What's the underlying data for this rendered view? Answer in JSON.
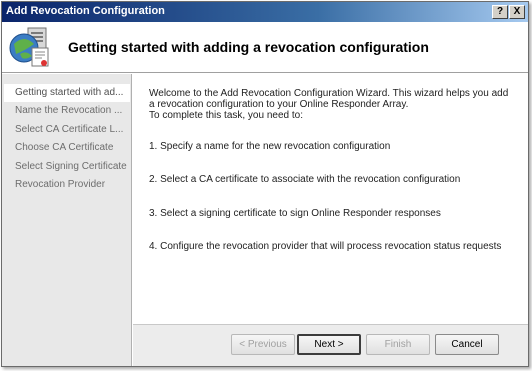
{
  "window": {
    "title": "Add Revocation Configuration",
    "help_glyph": "?",
    "close_glyph": "X"
  },
  "header": {
    "title": "Getting started with adding a revocation configuration"
  },
  "sidebar": {
    "items": [
      {
        "label": "Getting started with ad..."
      },
      {
        "label": "Name the Revocation ..."
      },
      {
        "label": "Select CA Certificate L..."
      },
      {
        "label": "Choose CA Certificate"
      },
      {
        "label": "Select Signing Certificate"
      },
      {
        "label": "Revocation Provider"
      }
    ]
  },
  "content": {
    "intro_line1": "Welcome to the Add Revocation Configuration Wizard. This wizard helps you add",
    "intro_line2": "a revocation configuration to your Online Responder Array.",
    "intro_line3": "To complete this task, you need to:",
    "step1": "1. Specify a name for the new revocation configuration",
    "step2": "2. Select a CA certificate to associate with the revocation configuration",
    "step3": "3. Select a signing certificate to sign Online Responder responses",
    "step4": "4. Configure the revocation provider that will process revocation status requests"
  },
  "buttons": {
    "previous": "< Previous",
    "next": "Next >",
    "finish": "Finish",
    "cancel": "Cancel"
  }
}
